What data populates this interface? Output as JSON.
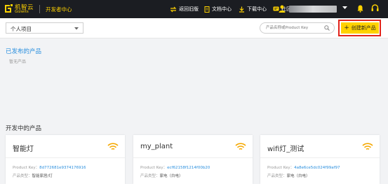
{
  "brand": {
    "name_cn": "机智云",
    "name_en": "Gizwits",
    "portal_label": "开发者中心",
    "accent_color": "#ffd200"
  },
  "nav": {
    "items": [
      {
        "label": "返回旧版",
        "icon": "swap-icon"
      },
      {
        "label": "文档中心",
        "icon": "document-icon"
      },
      {
        "label": "下载中心",
        "icon": "download-icon"
      },
      {
        "label": "社区",
        "icon": "community-icon"
      }
    ]
  },
  "toolbar": {
    "project_select_value": "个人项目",
    "search_placeholder": "产品名称或Product Key",
    "create_button_label": "创建新产品",
    "create_button_color": "#ffd200",
    "highlight_color": "#e2231a"
  },
  "published": {
    "title": "已发布的产品",
    "empty_text": "暂无产品"
  },
  "developing": {
    "title": "开发中的产品",
    "products": [
      {
        "name": "智能灯",
        "product_key_label": "Product Key：",
        "product_key": "8d772681e9374176916",
        "category_label": "产品类型：",
        "category": "智能家居/灯"
      },
      {
        "name": "my_plant",
        "product_key_label": "Product Key：",
        "product_key": "ecf62158f1214f00b20",
        "category_label": "产品类型：",
        "category": "家电（白电）"
      },
      {
        "name": "wifi灯_测试",
        "product_key_label": "Product Key：",
        "product_key": "4a8e6ce5dc024f99af97",
        "category_label": "产品类型：",
        "category": "家电（白电）"
      }
    ]
  }
}
